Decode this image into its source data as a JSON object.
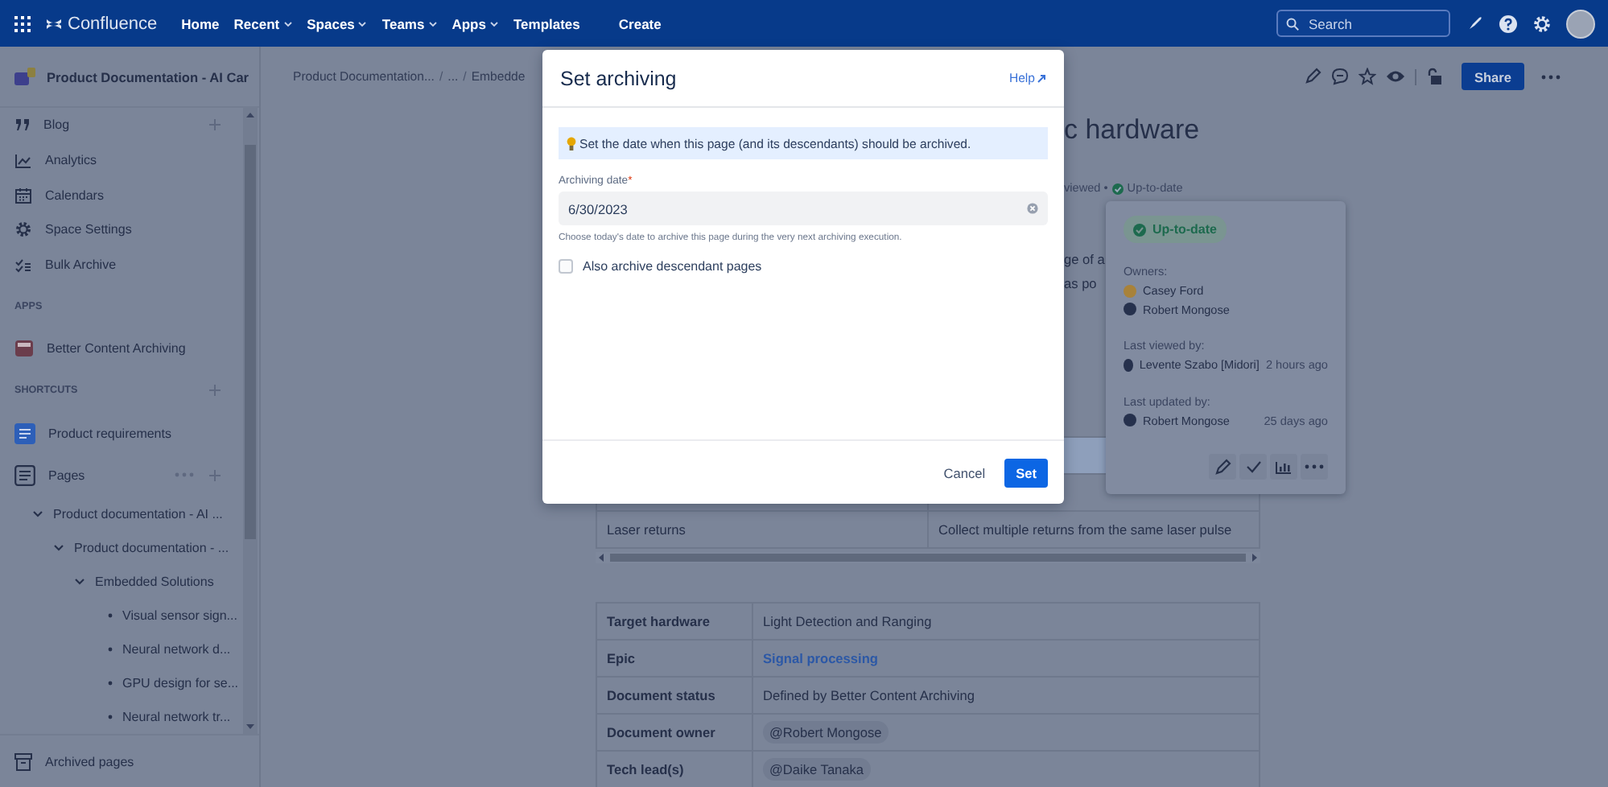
{
  "top_nav": {
    "product": "Confluence",
    "links": [
      {
        "label": "Home",
        "dropdown": false
      },
      {
        "label": "Recent",
        "dropdown": true
      },
      {
        "label": "Spaces",
        "dropdown": true
      },
      {
        "label": "Teams",
        "dropdown": true
      },
      {
        "label": "Apps",
        "dropdown": true
      },
      {
        "label": "Templates",
        "dropdown": false
      }
    ],
    "create": "Create",
    "search": {
      "placeholder": "Search"
    }
  },
  "sidebar": {
    "space_title": "Product Documentation - AI Car",
    "items": [
      {
        "label": "Blog"
      },
      {
        "label": "Analytics"
      },
      {
        "label": "Calendars"
      },
      {
        "label": "Space Settings"
      },
      {
        "label": "Bulk Archive"
      }
    ],
    "apps_heading": "APPS",
    "apps": [
      {
        "label": "Better Content Archiving"
      }
    ],
    "shortcuts_heading": "SHORTCUTS",
    "shortcuts": [
      {
        "label": "Product requirements"
      }
    ],
    "pages_heading": "Pages",
    "tree": [
      {
        "label": "Product documentation - AI ...",
        "expanded": true,
        "children": [
          {
            "label": "Product documentation - ...",
            "expanded": true,
            "children": [
              {
                "label": "Embedded Solutions",
                "expanded": true,
                "children": [
                  {
                    "label": "Visual sensor sign..."
                  },
                  {
                    "label": "Neural network d..."
                  },
                  {
                    "label": "GPU design for se..."
                  },
                  {
                    "label": "Neural network tr..."
                  }
                ]
              }
            ]
          }
        ]
      }
    ],
    "archived": "Archived pages"
  },
  "breadcrumb": [
    {
      "kind": "link",
      "text": "Product Documentation..."
    },
    {
      "kind": "separator",
      "text": "/"
    },
    {
      "kind": "link",
      "text": "..."
    },
    {
      "kind": "separator",
      "text": "/"
    },
    {
      "kind": "link",
      "text": "Embedde"
    }
  ],
  "page_actions": {
    "share": "Share"
  },
  "page_fragments": {
    "title": "c hardware",
    "byline": "viewed •",
    "status": "Up-to-date",
    "body_lines": [
      "ge of a",
      "as po"
    ]
  },
  "status_popover": {
    "status": "Up-to-date",
    "owners_label": "Owners:",
    "owners": [
      "Casey Ford",
      "Robert Mongose"
    ],
    "last_viewed": {
      "label": "Last viewed by:",
      "name": "Levente Szabo [Midori]",
      "time": "2 hours ago"
    },
    "last_updated": {
      "label": "Last updated by:",
      "name": "Robert Mongose",
      "time": "25 days ago"
    }
  },
  "table_1": {
    "rows": [
      [
        "Laser returns",
        "Collect multiple returns from the same laser pulse"
      ]
    ]
  },
  "table_2": {
    "rows": [
      {
        "label": "Target hardware",
        "value": "Light Detection and Ranging",
        "kind": "text"
      },
      {
        "label": "Epic",
        "value": "Signal processing",
        "kind": "link"
      },
      {
        "label": "Document status",
        "value": "Defined by Better Content Archiving",
        "kind": "text"
      },
      {
        "label": "Document owner",
        "value": "@Robert Mongose",
        "kind": "mention"
      },
      {
        "label": "Tech lead(s)",
        "value": "@Daike Tanaka",
        "kind": "mention"
      }
    ]
  },
  "modal": {
    "title": "Set archiving",
    "help": "Help",
    "info": "Set the date when this page (and its descendants) should be archived.",
    "field": {
      "label": "Archiving date",
      "required_marker": "*",
      "value": "6/30/2023"
    },
    "hint": "Choose today's date to archive this page during the very next archiving execution.",
    "checkbox": {
      "label": "Also archive descendant pages",
      "checked": false
    },
    "cancel": "Cancel",
    "confirm": "Set"
  }
}
